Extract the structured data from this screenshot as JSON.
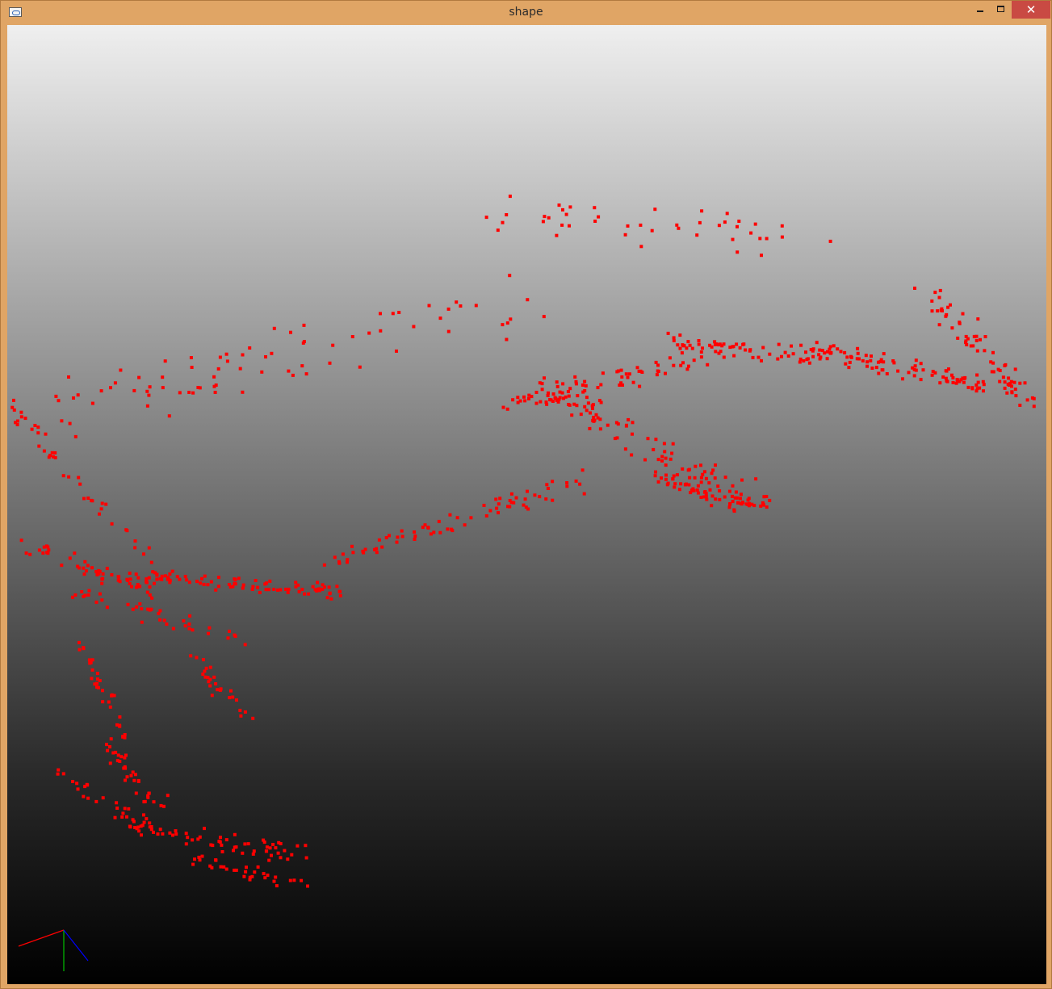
{
  "window": {
    "title": "shape",
    "close_label": "✕"
  },
  "scene": {
    "background_top": "#efefef",
    "background_bottom": "#000000",
    "point_color": "#ff0000",
    "point_count": 1100,
    "axes": {
      "x_color": "#ff0000",
      "y_color": "#00c000",
      "z_color": "#0000ff"
    }
  },
  "icons": {
    "app": "app-window-icon",
    "minimize": "minimize-icon",
    "maximize": "maximize-icon",
    "close": "close-icon"
  }
}
